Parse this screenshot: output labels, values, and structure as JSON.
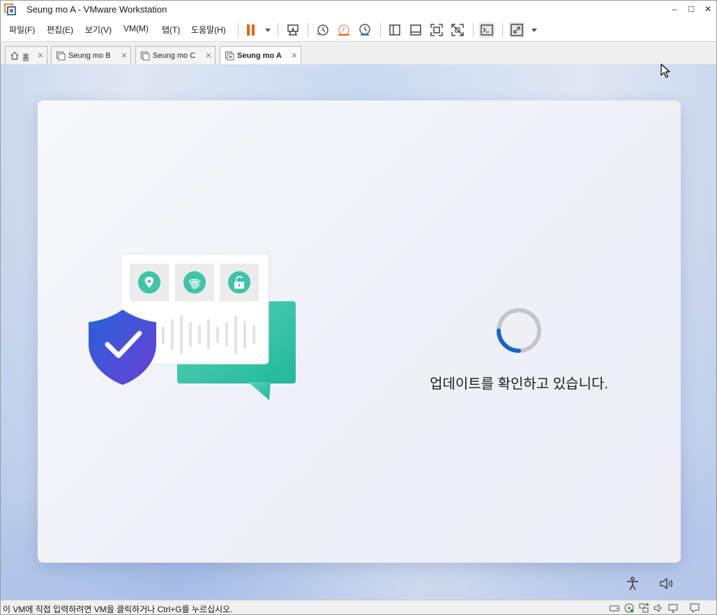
{
  "window": {
    "title": "Seung mo A - VMware Workstation",
    "minimize": "–",
    "maximize": "□",
    "close": "✕"
  },
  "menu": {
    "items": [
      "파일(F)",
      "편집(E)",
      "보기(V)",
      "VM(M)",
      "탭(T)",
      "도움말(H)"
    ]
  },
  "toolbar": {
    "icons": [
      "pause-icon",
      "dropdown-arrow-icon",
      "send-ctrl-alt-del-icon",
      "snapshot-icon",
      "revert-snapshot-icon",
      "snapshot-manager-icon",
      "show-library-icon",
      "thumbnail-bar-icon",
      "full-screen-icon",
      "unity-icon",
      "console-view-icon",
      "stretch-guest-icon",
      "view-dropdown-icon"
    ],
    "accent": "#e8620c"
  },
  "tabs": [
    {
      "label": "홈",
      "icon": "home-icon",
      "active": false
    },
    {
      "label": "Seung mo B",
      "icon": "vm-icon",
      "active": false
    },
    {
      "label": "Seung mo C",
      "icon": "vm-icon",
      "active": false
    },
    {
      "label": "Seung mo A",
      "icon": "vm-running-icon",
      "active": true
    }
  ],
  "vm": {
    "status_text": "업데이트를 확인하고 있습니다.",
    "spinner_accent": "#1566c4",
    "spinner_track": "#c3c5c9"
  },
  "statusbar": {
    "message": "이 VM에 직접 입력하려면 VM을 클릭하거나 Ctrl+G를 누르십시오.",
    "icons": [
      "hard-disk-icon",
      "cd-rom-icon",
      "network-icon",
      "sound-icon",
      "display-icon",
      "message-icon"
    ]
  }
}
